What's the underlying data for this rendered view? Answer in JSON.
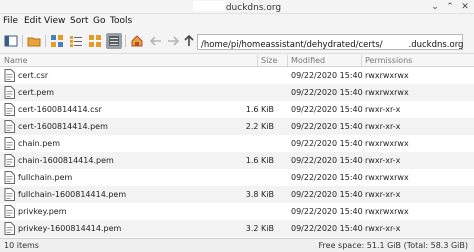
{
  "window": {
    "title": "duckdns.org",
    "controls": [
      "minimize-icon",
      "maximize-icon",
      "close-icon"
    ]
  },
  "menu": [
    "File",
    "Edit",
    "View",
    "Sort",
    "Go",
    "Tools"
  ],
  "toolbar": {
    "path": "/home/pi/homeassistant/dehydrated/certs/",
    "path_suffix": ".duckdns.org",
    "icons": [
      "sidebar-toggle-icon",
      "new-folder-icon",
      "icon-view-icon",
      "compact-view-icon",
      "list-view-icon",
      "detailed-view-icon",
      "home-icon",
      "back-icon",
      "forward-icon",
      "up-icon"
    ]
  },
  "columns": {
    "name": "Name",
    "size": "Size",
    "modified": "Modified",
    "permissions": "Permissions"
  },
  "files": [
    {
      "name": "cert.csr",
      "size": "",
      "modified": "09/22/2020 15:40",
      "perms": "rwxrwxrwx"
    },
    {
      "name": "cert.pem",
      "size": "",
      "modified": "09/22/2020 15:40",
      "perms": "rwxrwxrwx"
    },
    {
      "name": "cert-1600814414.csr",
      "size": "1.6 KiB",
      "modified": "09/22/2020 15:40",
      "perms": "rwxr-xr-x"
    },
    {
      "name": "cert-1600814414.pem",
      "size": "2.2 KiB",
      "modified": "09/22/2020 15:40",
      "perms": "rwxr-xr-x"
    },
    {
      "name": "chain.pem",
      "size": "",
      "modified": "09/22/2020 15:40",
      "perms": "rwxrwxrwx"
    },
    {
      "name": "chain-1600814414.pem",
      "size": "1.6 KiB",
      "modified": "09/22/2020 15:40",
      "perms": "rwxr-xr-x"
    },
    {
      "name": "fullchain.pem",
      "size": "",
      "modified": "09/22/2020 15:40",
      "perms": "rwxrwxrwx"
    },
    {
      "name": "fullchain-1600814414.pem",
      "size": "3.8 KiB",
      "modified": "09/22/2020 15:40",
      "perms": "rwxr-xr-x"
    },
    {
      "name": "privkey.pem",
      "size": "",
      "modified": "09/22/2020 15:40",
      "perms": "rwxrwxrwx"
    },
    {
      "name": "privkey-1600814414.pem",
      "size": "3.2 KiB",
      "modified": "09/22/2020 15:40",
      "perms": "rwxr-xr-x"
    }
  ],
  "status": {
    "count": "10 items",
    "space": "Free space: 51.1 GiB (Total: 58.3 GiB)"
  }
}
